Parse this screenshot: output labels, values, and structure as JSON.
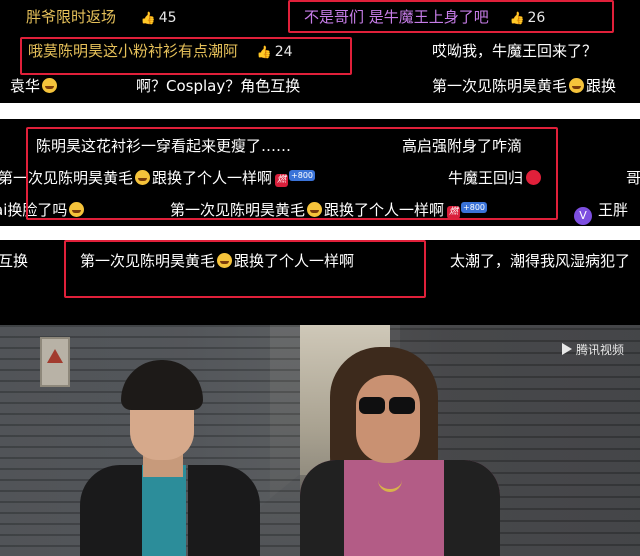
{
  "panel1": {
    "row1": {
      "c1": {
        "text": "胖爷限时返场",
        "likes": "45"
      },
      "c2": {
        "text": "不是哥们 是牛魔王上身了吧",
        "likes": "26"
      }
    },
    "row2": {
      "c1": {
        "text": "哦莫陈明昊这小粉衬衫有点潮阿",
        "likes": "24"
      },
      "c2": {
        "text": "哎呦我，牛魔王回来了？"
      }
    },
    "row3": {
      "c1": "袁华",
      "c2": "啊？Cosplay？角色互换",
      "c3": "第一次见陈明昊黄毛",
      "c3_suffix": "跟换"
    }
  },
  "panel2": {
    "row1": {
      "c1": "陈明昊这花衬衫一穿看起来更瘦了……",
      "c2": "高启强附身了咋滴"
    },
    "row2": {
      "c1": "第一次见陈明昊黄毛",
      "c1_suffix": "跟换了个人一样啊",
      "badge": "+800",
      "c2": "牛魔王回归"
    },
    "row3": {
      "c0": "ai换脸了吗",
      "c1": "第一次见陈明昊黄毛",
      "c1_suffix": "跟换了个人一样啊",
      "badge": "+800",
      "c2": "王胖"
    }
  },
  "panel3": {
    "row1": {
      "c0": "互换",
      "c1": "第一次见陈明昊黄毛",
      "c1_suffix": "跟换了个人一样啊",
      "c2": "太潮了，潮得我风湿病犯了"
    }
  },
  "video": {
    "watermark": "腾讯视频"
  },
  "colors": {
    "highlight_box": "#e0203a",
    "gold_text": "#e6c15a"
  }
}
